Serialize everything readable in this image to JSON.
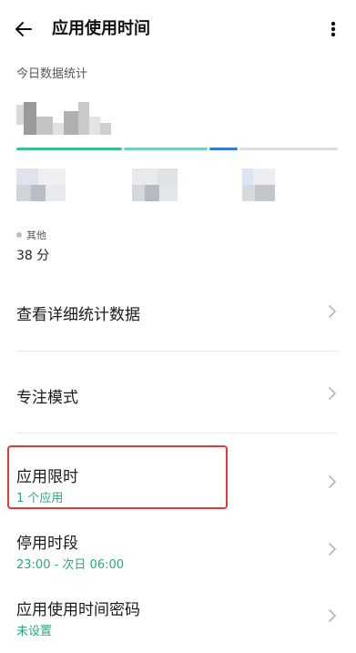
{
  "header": {
    "title": "应用使用时间",
    "back_icon": "arrow-left-icon",
    "more_icon": "more-vertical-icon"
  },
  "stats": {
    "section_label": "今日数据统计",
    "progress_colors": [
      "#3cbf8f",
      "#6fd0c3",
      "#2f7fd9",
      "#dcdcdc"
    ],
    "other": {
      "label": "其他",
      "value": "38 分"
    }
  },
  "menu": {
    "details": {
      "label": "查看详细统计数据"
    },
    "focus": {
      "label": "专注模式"
    },
    "app_limit": {
      "label": "应用限时",
      "sub": "1 个应用"
    },
    "downtime": {
      "label": "停用时段",
      "sub": "23:00 - 次日 06:00"
    },
    "password": {
      "label": "应用使用时间密码",
      "sub": "未设置"
    }
  }
}
